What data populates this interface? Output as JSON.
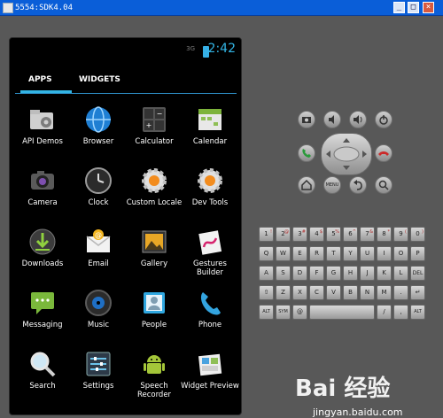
{
  "window": {
    "title": "5554:SDK4.04",
    "min_glyph": "_",
    "max_glyph": "□",
    "close_glyph": "×"
  },
  "status_bar": {
    "signal_label": "3G",
    "time": "2:42"
  },
  "tabs": [
    {
      "label": "APPS",
      "selected": true
    },
    {
      "label": "WIDGETS",
      "selected": false
    }
  ],
  "apps": [
    {
      "label": "API Demos",
      "icon": "folder-gear-icon"
    },
    {
      "label": "Browser",
      "icon": "globe-icon"
    },
    {
      "label": "Calculator",
      "icon": "calculator-icon"
    },
    {
      "label": "Calendar",
      "icon": "calendar-icon"
    },
    {
      "label": "Camera",
      "icon": "camera-icon"
    },
    {
      "label": "Clock",
      "icon": "clock-icon"
    },
    {
      "label": "Custom Locale",
      "icon": "gear-icon"
    },
    {
      "label": "Dev Tools",
      "icon": "gear-icon"
    },
    {
      "label": "Downloads",
      "icon": "download-icon"
    },
    {
      "label": "Email",
      "icon": "email-icon"
    },
    {
      "label": "Gallery",
      "icon": "gallery-icon"
    },
    {
      "label": "Gestures Builder",
      "icon": "gestures-icon"
    },
    {
      "label": "Messaging",
      "icon": "message-icon"
    },
    {
      "label": "Music",
      "icon": "music-icon"
    },
    {
      "label": "People",
      "icon": "people-icon"
    },
    {
      "label": "Phone",
      "icon": "phone-icon"
    },
    {
      "label": "Search",
      "icon": "search-icon"
    },
    {
      "label": "Settings",
      "icon": "settings-icon"
    },
    {
      "label": "Speech Recorder",
      "icon": "android-icon"
    },
    {
      "label": "Widget Preview",
      "icon": "widget-preview-icon"
    }
  ],
  "hardware_buttons": {
    "row1": [
      "camera-icon",
      "volume-down-icon",
      "volume-up-icon",
      "power-icon"
    ],
    "row2": [
      "call-icon",
      "dpad-icon",
      "end-call-icon"
    ],
    "row3": [
      "home-icon",
      "menu-icon",
      "back-icon",
      "search-icon"
    ],
    "menu_label": "MENU"
  },
  "keyboard": {
    "rows": [
      [
        "1",
        "2",
        "3",
        "4",
        "5",
        "6",
        "7",
        "8",
        "9",
        "0"
      ],
      [
        "Q",
        "W",
        "E",
        "R",
        "T",
        "Y",
        "U",
        "I",
        "O",
        "P"
      ],
      [
        "A",
        "S",
        "D",
        "F",
        "G",
        "H",
        "J",
        "K",
        "L",
        "DEL"
      ],
      [
        "⇧",
        "Z",
        "X",
        "C",
        "V",
        "B",
        "N",
        "M",
        ".",
        "↵"
      ],
      [
        "ALT",
        "SYM",
        "@",
        "",
        "",
        "",
        "/",
        ",",
        "ALT"
      ]
    ],
    "number_symbols": [
      "!",
      "@",
      "#",
      "$",
      "%",
      "^",
      "&",
      "*",
      "(",
      ")"
    ]
  },
  "watermark": {
    "text": "Bai 经验",
    "url": "jingyan.baidu.com"
  }
}
